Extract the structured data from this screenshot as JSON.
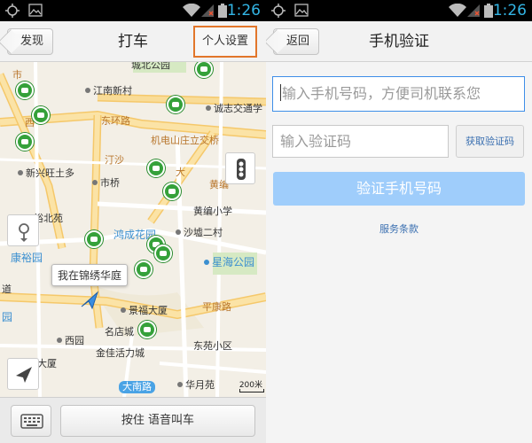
{
  "status_bar": {
    "time": "1:26"
  },
  "left_screen": {
    "nav": {
      "back_label": "发现",
      "title": "打车",
      "settings_label": "个人设置"
    },
    "map": {
      "location_tip": "我在锦绣华庭",
      "scale_label": "200米",
      "labels": {
        "jiangnan_village": "江南新村",
        "chengbei_park": "城北公园",
        "chengxin_traffic": "诚志交通学",
        "donghuan_road": "东环路",
        "jidian_bridge": "机电山庄立交桥",
        "xinxing_wangtuo": "新兴旺土多",
        "tinsha": "汀沙",
        "shiqiao": "市桥",
        "xi": "西",
        "da": "大",
        "huangbian": "黄编",
        "yubeiyuan": "裕北苑",
        "huangbian_primary": "黄编小学",
        "hongcheng_garden": "鸿成花园",
        "shaxu_village": "沙墟二村",
        "kangyu_garden": "康裕园",
        "xingdao_park": "星海公园",
        "dao": "道",
        "jingfu_building": "景福大厦",
        "pingkang_road": "平康路",
        "yuan": "园",
        "west_garden": "西园",
        "mingdian_city": "名店城",
        "dongyuan_district": "东苑小区",
        "jinjia_plaza": "金佳活力城",
        "da_building": "大厦",
        "danan_road": "大南路",
        "huayue_garden": "华月苑",
        "shi": "市"
      }
    },
    "bottom": {
      "voice_label": "按住 语音叫车"
    }
  },
  "right_screen": {
    "nav": {
      "back_label": "返回",
      "title": "手机验证"
    },
    "phone_placeholder": "输入手机号码，方便司机联系您",
    "code_placeholder": "输入验证码",
    "get_code_label": "获取验证码",
    "verify_label": "验证手机号码",
    "terms_label": "服务条款"
  },
  "colors": {
    "accent_blue": "#3e8ee8",
    "highlight_orange": "#e2762b",
    "taxi_green": "#35a13a",
    "status_time": "#33b5e5",
    "verify_button": "#9fcdfb"
  },
  "icons": [
    "gps-icon",
    "image-icon",
    "wifi-icon",
    "no-signal-icon",
    "battery-icon",
    "traffic-icon",
    "locate-icon",
    "compass-icon",
    "keyboard-icon",
    "taxi-icon"
  ]
}
